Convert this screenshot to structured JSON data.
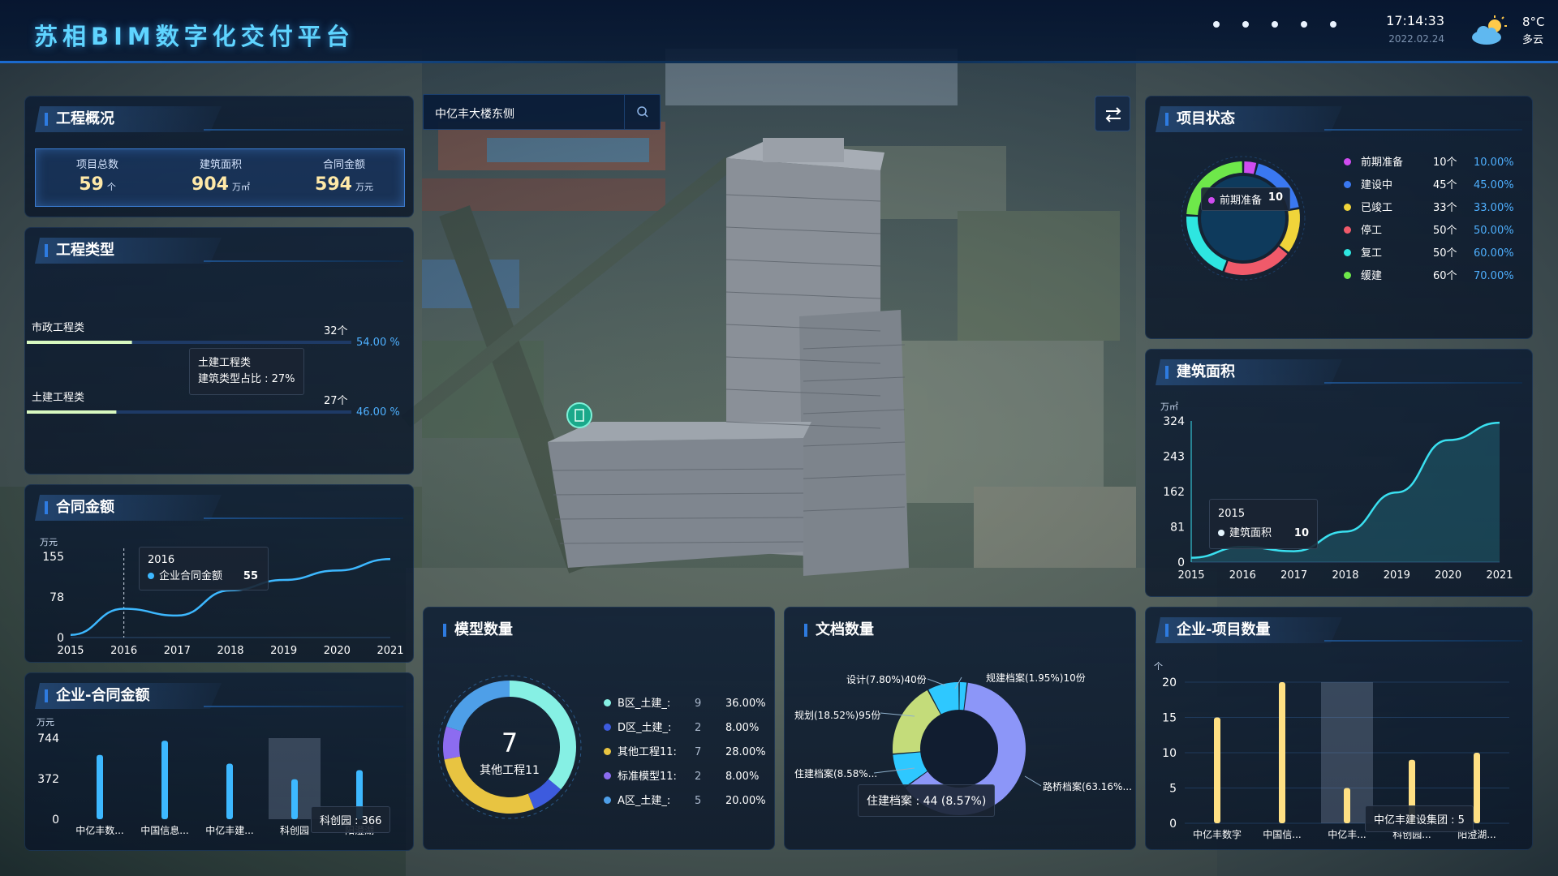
{
  "header": {
    "title": "苏相BIM数字化交付平台",
    "time": "17:14:33",
    "date": "2022.02.24",
    "weather": {
      "temp": "8°C",
      "condition": "多云",
      "icon": "partly-cloudy-icon"
    }
  },
  "search": {
    "value": "中亿丰大楼东侧",
    "icon": "search-icon"
  },
  "swap_button": {
    "icon": "swap-arrows-icon"
  },
  "map_marker": {
    "icon": "building-pin-icon"
  },
  "overview": {
    "title": "工程概况",
    "stats": [
      {
        "label": "项目总数",
        "value": "59",
        "unit": "个"
      },
      {
        "label": "建筑面积",
        "value": "904",
        "unit": "万㎡"
      },
      {
        "label": "合同金额",
        "value": "594",
        "unit": "万元"
      }
    ]
  },
  "project_types": {
    "title": "工程类型",
    "items": [
      {
        "name": "市政工程类",
        "count": "32个",
        "percent": "54.00 %",
        "fraction": 0.54
      },
      {
        "name": "土建工程类",
        "count": "27个",
        "percent": "46.00 %",
        "fraction": 0.46
      }
    ],
    "tooltip": {
      "line1": "土建工程类",
      "line2": "建筑类型占比 : 27%"
    }
  },
  "contract_amount": {
    "title": "合同金额",
    "unit": "万元",
    "tooltip": {
      "year": "2016",
      "series": "企业合同金额",
      "value": "55"
    }
  },
  "enterprise_contract": {
    "title": "企业-合同金额",
    "unit": "万元",
    "tooltip": {
      "label": "科创园 : 366"
    }
  },
  "model_count": {
    "title": "模型数量",
    "center_value": "7",
    "center_label": "其他工程11",
    "legend": [
      {
        "name": "B区_土建_:",
        "count": "9",
        "percent": "36.00%",
        "color": "#86f0e4"
      },
      {
        "name": "D区_土建_:",
        "count": "2",
        "percent": "8.00%",
        "color": "#3d5bde"
      },
      {
        "name": "其他工程11:",
        "count": "7",
        "percent": "28.00%",
        "color": "#e8c441"
      },
      {
        "name": "标准模型11:",
        "count": "2",
        "percent": "8.00%",
        "color": "#8c6cf0"
      },
      {
        "name": "A区_土建_:",
        "count": "5",
        "percent": "20.00%",
        "color": "#4e9fe8"
      }
    ]
  },
  "document_count": {
    "title": "文档数量",
    "labels": [
      {
        "text": "规建档案(1.95%)10份"
      },
      {
        "text": "设计(7.80%)40份"
      },
      {
        "text": "规划(18.52%)95份"
      },
      {
        "text": "住建档案(8.58%..."
      },
      {
        "text": "路桥档案(63.16%..."
      }
    ],
    "tooltip": {
      "label": "住建档案 : 44 (8.57%)"
    }
  },
  "project_status": {
    "title": "项目状态",
    "center": {
      "label": "前期准备",
      "value": "10"
    },
    "legend": [
      {
        "name": "前期准备",
        "count": "10个",
        "percent": "10.00%",
        "color": "#d04cf0"
      },
      {
        "name": "建设中",
        "count": "45个",
        "percent": "45.00%",
        "color": "#3a78f0"
      },
      {
        "name": "已竣工",
        "count": "33个",
        "percent": "33.00%",
        "color": "#f0d43a"
      },
      {
        "name": "停工",
        "count": "50个",
        "percent": "50.00%",
        "color": "#f05a6a"
      },
      {
        "name": "复工",
        "count": "50个",
        "percent": "60.00%",
        "color": "#2ee6e0"
      },
      {
        "name": "缓建",
        "count": "60个",
        "percent": "70.00%",
        "color": "#6ee84a"
      }
    ]
  },
  "building_area": {
    "title": "建筑面积",
    "unit": "万㎡",
    "tooltip": {
      "year": "2015",
      "series": "建筑面积",
      "value": "10"
    }
  },
  "enterprise_projects": {
    "title": "企业-项目数量",
    "unit": "个",
    "tooltip": {
      "label": "中亿丰建设集团 : 5"
    }
  },
  "chart_data": [
    {
      "id": "contract_amount",
      "type": "line",
      "title": "合同金额",
      "ylabel": "万元",
      "x": [
        "2015",
        "2016",
        "2017",
        "2018",
        "2019",
        "2020",
        "2021"
      ],
      "yticks": [
        "155",
        "78",
        "0"
      ],
      "ylim": [
        0,
        155
      ],
      "series": [
        {
          "name": "企业合同金额",
          "values": [
            5,
            55,
            42,
            90,
            110,
            128,
            150
          ],
          "color": "#3db8ff"
        }
      ]
    },
    {
      "id": "building_area",
      "type": "area",
      "title": "建筑面积",
      "ylabel": "万㎡",
      "x": [
        "2015",
        "2016",
        "2017",
        "2018",
        "2019",
        "2020",
        "2021"
      ],
      "yticks": [
        "324",
        "243",
        "162",
        "81",
        "0"
      ],
      "ylim": [
        0,
        324
      ],
      "series": [
        {
          "name": "建筑面积",
          "values": [
            10,
            35,
            25,
            70,
            160,
            280,
            320
          ],
          "color": "#3ae0f0"
        }
      ]
    },
    {
      "id": "enterprise_contract",
      "type": "bar",
      "title": "企业-合同金额",
      "ylabel": "万元",
      "categories": [
        "中亿丰数...",
        "中国信息...",
        "中亿丰建...",
        "科创园",
        "阳澄湖"
      ],
      "yticks": [
        "744",
        "372",
        "0"
      ],
      "ylim": [
        0,
        744
      ],
      "values": [
        590,
        720,
        510,
        366,
        450
      ],
      "color": "#3db8ff",
      "highlight_index": 3
    },
    {
      "id": "enterprise_projects",
      "type": "bar",
      "title": "企业-项目数量",
      "ylabel": "个",
      "categories": [
        "中亿丰数字",
        "中国信...",
        "中亿丰...",
        "科创园...",
        "阳澄湖..."
      ],
      "yticks": [
        "20",
        "15",
        "10",
        "5",
        "0"
      ],
      "ylim": [
        0,
        20
      ],
      "values": [
        15,
        20,
        5,
        9,
        10
      ],
      "color": "#ffe083",
      "highlight_index": 2
    },
    {
      "id": "model_count",
      "type": "pie",
      "title": "模型数量",
      "categories": [
        "B区_土建_",
        "D区_土建_",
        "其他工程11",
        "标准模型11",
        "A区_土建_"
      ],
      "values": [
        9,
        2,
        7,
        2,
        5
      ]
    },
    {
      "id": "document_count",
      "type": "pie",
      "title": "文档数量",
      "categories": [
        "规建档案",
        "路桥档案",
        "住建档案",
        "规划",
        "设计"
      ],
      "values": [
        10,
        324,
        44,
        95,
        40
      ]
    },
    {
      "id": "project_status",
      "type": "pie",
      "title": "项目状态",
      "categories": [
        "前期准备",
        "建设中",
        "已竣工",
        "停工",
        "复工",
        "缓建"
      ],
      "values": [
        10,
        45,
        33,
        50,
        50,
        60
      ]
    }
  ]
}
